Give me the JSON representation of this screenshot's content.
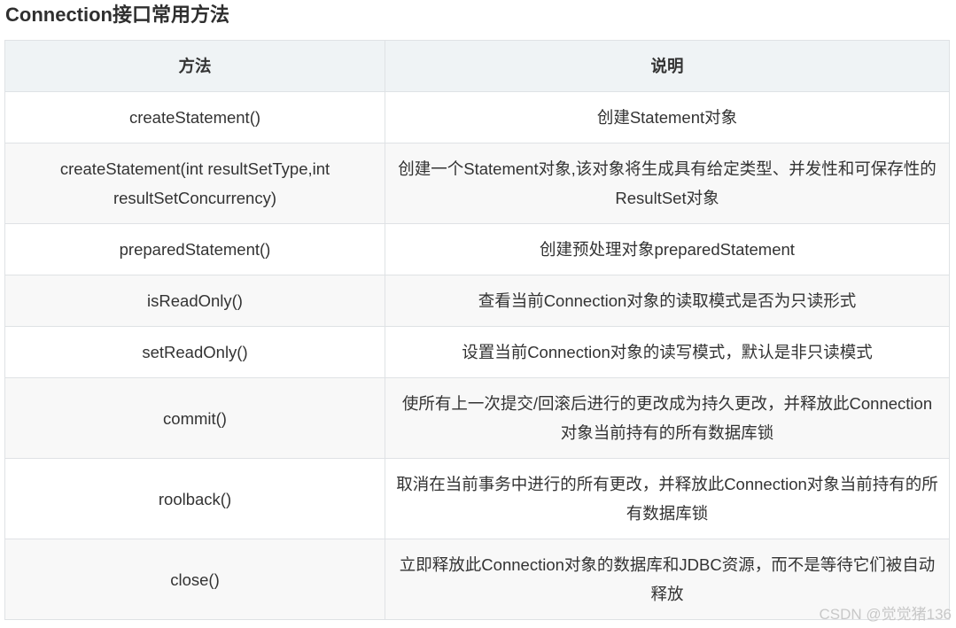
{
  "title": "Connection接口常用方法",
  "table": {
    "headers": [
      "方法",
      "说明"
    ],
    "rows": [
      {
        "method": "createStatement()",
        "desc": "创建Statement对象"
      },
      {
        "method": "createStatement(int resultSetType,int resultSetConcurrency)",
        "desc": "创建一个Statement对象,该对象将生成具有给定类型、并发性和可保存性的ResultSet对象"
      },
      {
        "method": "preparedStatement()",
        "desc": "创建预处理对象preparedStatement"
      },
      {
        "method": "isReadOnly()",
        "desc": "查看当前Connection对象的读取模式是否为只读形式"
      },
      {
        "method": "setReadOnly()",
        "desc": "设置当前Connection对象的读写模式，默认是非只读模式"
      },
      {
        "method": "commit()",
        "desc": "使所有上一次提交/回滚后进行的更改成为持久更改，并释放此Connection对象当前持有的所有数据库锁"
      },
      {
        "method": "roolback()",
        "desc": "取消在当前事务中进行的所有更改，并释放此Connection对象当前持有的所有数据库锁"
      },
      {
        "method": "close()",
        "desc": "立即释放此Connection对象的数据库和JDBC资源，而不是等待它们被自动释放"
      }
    ]
  },
  "watermark": "CSDN @觉觉猪136"
}
